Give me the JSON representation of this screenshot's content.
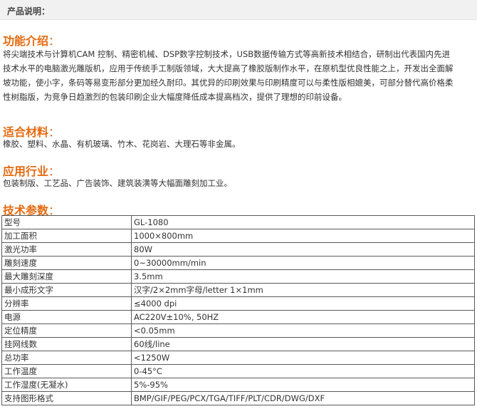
{
  "header": {
    "title": "产品说明："
  },
  "sections": {
    "features": {
      "heading": "功能介绍",
      "lines": [
        "将尖端技术与计算机CAM 控制、精密机械、DSP数字控制技术，USB数据传输方式等高新技术相结合，研制出代表国内先进",
        "技术水平的电脑激光雕版机，应用于传统手工制版领域，大大提高了橡胶版制作水平，在原机型优良性能之上，开发出全面解",
        "坡功能，使小字，条码等易变形部分更加经久耐印。其优异的印刷效果与印刷精度可以与柔性版相媲美，可部分替代高价格柔",
        "性树脂版，为竞争日趋激烈的包装印刷企业大幅度降低成本提高档次，提供了理想的印前设备。"
      ]
    },
    "materials": {
      "heading": "适合材料",
      "text": "橡胶、塑料、水晶、有机玻璃、竹木、花岗岩、大理石等非金属。"
    },
    "industries": {
      "heading": "应用行业",
      "text": "包装制版、工艺品、广告装饰、建筑装潢等大幅面雕刻加工业。"
    },
    "specs": {
      "heading": "技术参数",
      "rows": [
        {
          "key": "型号",
          "value": "GL-1080"
        },
        {
          "key": "加工面积",
          "value": "1000×800mm"
        },
        {
          "key": "激光功率",
          "value": "80W"
        },
        {
          "key": "雕刻速度",
          "value": "0~30000mm/min"
        },
        {
          "key": "最大雕刻深度",
          "value": "3.5mm"
        },
        {
          "key": "最小成形文字",
          "value": "汉字/2×2mm字母/letter 1×1mm"
        },
        {
          "key": "分辨率",
          "value": "≤4000 dpi"
        },
        {
          "key": "电源",
          "value": "AC220V±10%, 50HZ"
        },
        {
          "key": "定位精度",
          "value": "<0.05mm"
        },
        {
          "key": "挂网线数",
          "value": "60线/line"
        },
        {
          "key": "总功率",
          "value": "<1250W"
        },
        {
          "key": "工作温度",
          "value": "0-45°C"
        },
        {
          "key": "工作湿度(无凝水)",
          "value": "5%-95%"
        },
        {
          "key": "支持图形格式",
          "value": "BMP/GIF/PEG/PCX/TGA/TIFF/PLT/CDR/DWG/DXF"
        }
      ]
    },
    "colon": "："
  },
  "colors": {
    "heading": "#e46a10",
    "text": "#333333",
    "header_bg": "#f1f1f1"
  }
}
